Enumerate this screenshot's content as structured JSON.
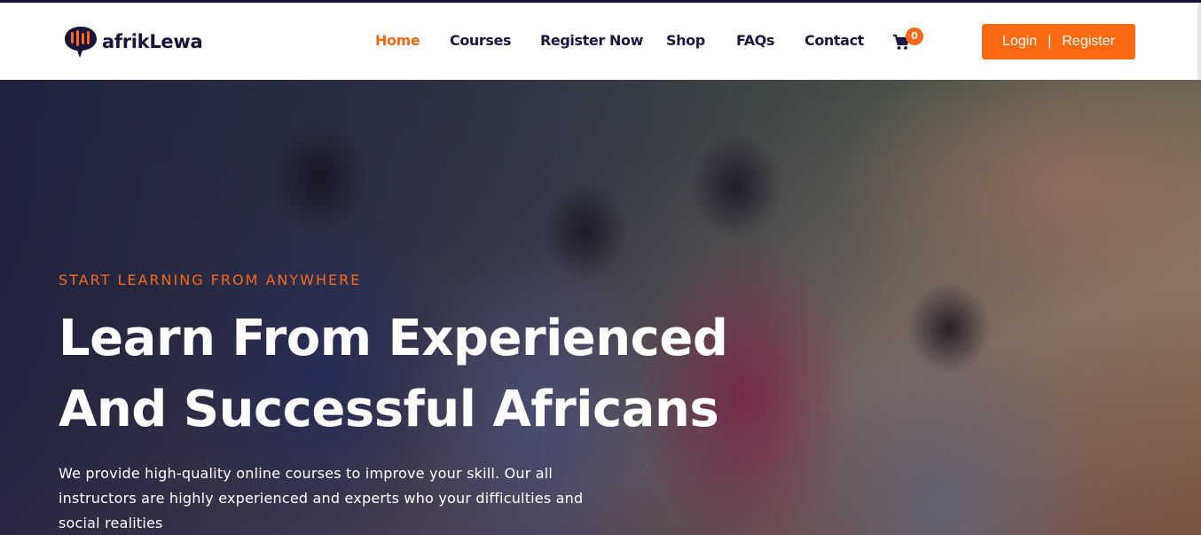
{
  "brand": {
    "name": "afrikLewa",
    "accent": "#f7681a",
    "navy": "#1b1742"
  },
  "nav": {
    "items": [
      {
        "label": "Home",
        "active": true
      },
      {
        "label": "Courses",
        "active": false
      },
      {
        "label": "Register Now",
        "active": false
      },
      {
        "label": "Shop",
        "active": false
      },
      {
        "label": "FAQs",
        "active": false
      },
      {
        "label": "Contact",
        "active": false
      }
    ],
    "cart": {
      "icon": "cart-icon",
      "count": "0"
    },
    "auth": {
      "login_label": "Login",
      "separator": "|",
      "register_label": "Register"
    }
  },
  "hero": {
    "eyebrow": "START LEARNING FROM ANYWHERE",
    "title_line1": "Learn From Experienced",
    "title_line2": "And Successful Africans",
    "description": "We provide high-quality online courses to improve your skill. Our all instructors are highly experienced and experts who your difficulties and social realities"
  }
}
